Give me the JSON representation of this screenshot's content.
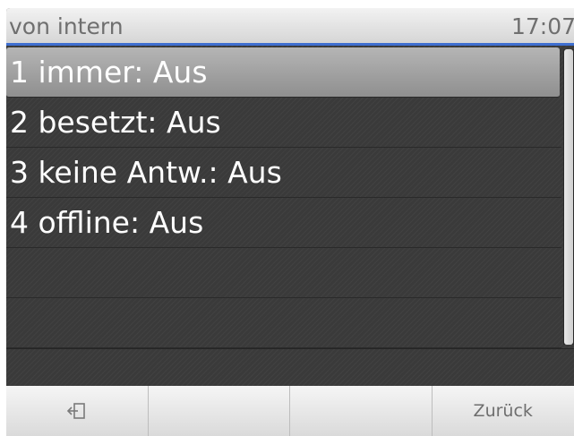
{
  "header": {
    "title": "von intern",
    "time": "17:07"
  },
  "list": {
    "items": [
      {
        "label": "1 immer: Aus",
        "selected": true
      },
      {
        "label": "2 besetzt: Aus",
        "selected": false
      },
      {
        "label": "3 keine Antw.: Aus",
        "selected": false
      },
      {
        "label": "4 offline: Aus",
        "selected": false
      },
      {
        "label": "",
        "selected": false
      },
      {
        "label": "",
        "selected": false
      }
    ]
  },
  "softkeys": {
    "key1_icon": "exit-icon",
    "key2_label": "",
    "key3_label": "",
    "key4_label": "Zurück"
  },
  "colors": {
    "header_accent": "#3f6fd1",
    "background": "#3a3a3a",
    "selected_row": "#a0a0a0"
  }
}
